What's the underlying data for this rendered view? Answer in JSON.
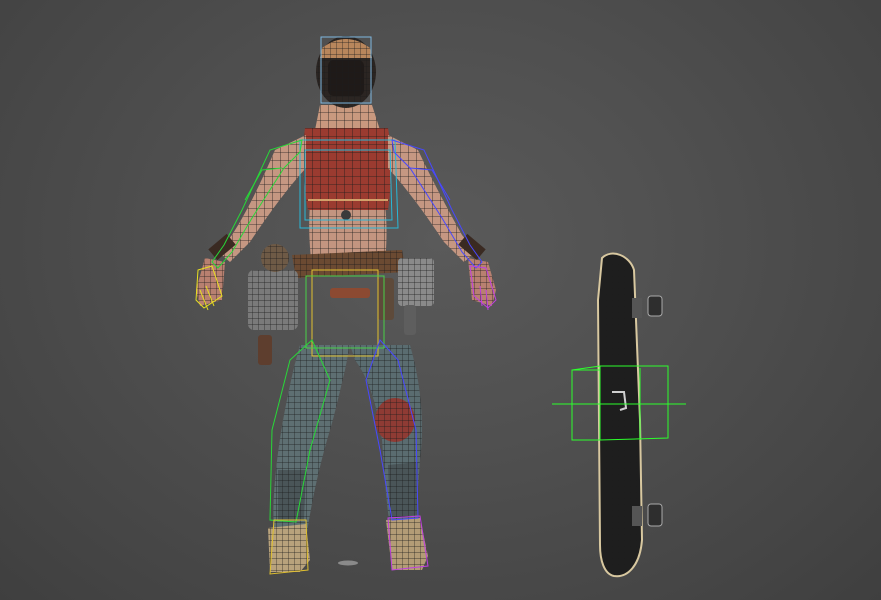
{
  "viewport": {
    "background_color": "#4f4f4f",
    "wire_color": "#1a1a1a",
    "skin_color": "#c99a86",
    "top_color": "#9c3a2f",
    "pants_color": "#5d6f74",
    "bone_colors": {
      "spine": "#3fd6ff",
      "left_arm": "#28d838",
      "right_arm": "#4a4aff",
      "hands": "#e0e020",
      "pelvis": "#e6c23a",
      "legs_left": "#28d838",
      "legs_right": "#4a4aff",
      "skate_gizmo": "#2cff2c"
    }
  },
  "objects": {
    "character": {
      "icon": "character-mesh"
    },
    "skateboard": {
      "icon": "skateboard-mesh"
    }
  }
}
